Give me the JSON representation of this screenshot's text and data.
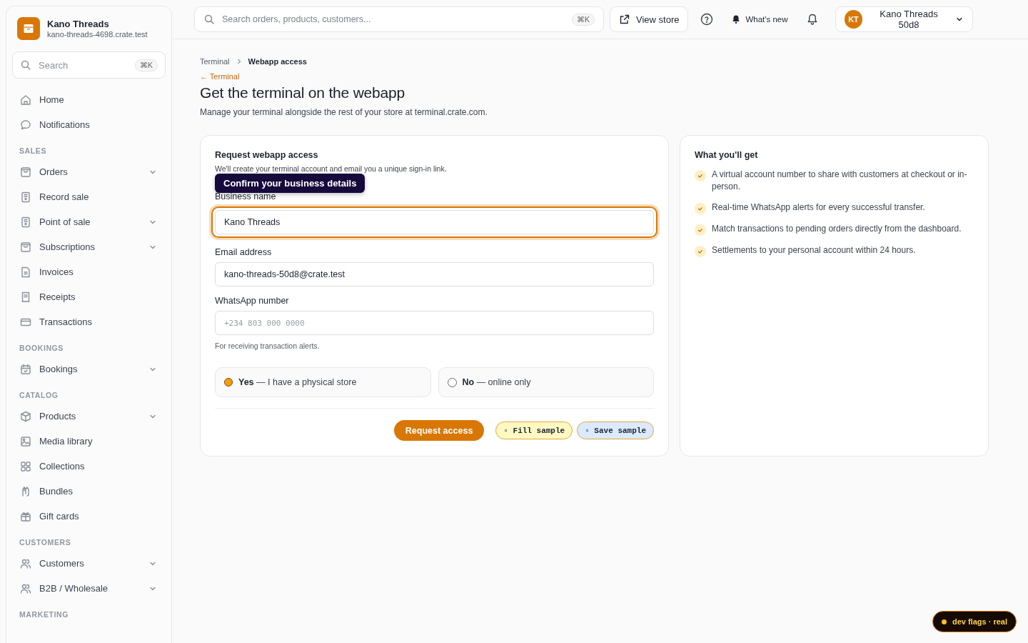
{
  "sidebar": {
    "store": {
      "name": "Kano Threads",
      "domain": "kano-threads-4698.crate.test"
    },
    "search": {
      "placeholder": "Search",
      "shortcut": "⌘K"
    },
    "top_items": [
      {
        "label": "Home",
        "expandable": false
      },
      {
        "label": "Notifications",
        "expandable": false
      }
    ],
    "sections": [
      {
        "heading": "SALES",
        "items": [
          {
            "label": "Orders",
            "expandable": true
          },
          {
            "label": "Record sale",
            "expandable": false
          },
          {
            "label": "Point of sale",
            "expandable": true
          },
          {
            "label": "Subscriptions",
            "expandable": true
          },
          {
            "label": "Invoices",
            "expandable": false
          },
          {
            "label": "Receipts",
            "expandable": false
          },
          {
            "label": "Transactions",
            "expandable": false
          }
        ]
      },
      {
        "heading": "BOOKINGS",
        "items": [
          {
            "label": "Bookings",
            "expandable": true
          }
        ]
      },
      {
        "heading": "CATALOG",
        "items": [
          {
            "label": "Products",
            "expandable": true
          },
          {
            "label": "Media library",
            "expandable": false
          },
          {
            "label": "Collections",
            "expandable": false
          },
          {
            "label": "Bundles",
            "expandable": false
          },
          {
            "label": "Gift cards",
            "expandable": false
          }
        ]
      },
      {
        "heading": "CUSTOMERS",
        "items": [
          {
            "label": "Customers",
            "expandable": true
          },
          {
            "label": "B2B / Wholesale",
            "expandable": true
          }
        ]
      },
      {
        "heading": "MARKETING"
      }
    ]
  },
  "topbar": {
    "search": {
      "placeholder": "Search orders, products, customers...",
      "shortcut": "⌘K"
    },
    "view_store": "View store",
    "whats_new": "What's new",
    "account": {
      "initials": "KT",
      "name": "Kano Threads 50d8"
    }
  },
  "breadcrumb": [
    "Terminal",
    "Webapp access"
  ],
  "back_link": "← Terminal",
  "title": "Get the terminal on the webapp",
  "subtitle": "Manage your terminal alongside the rest of your store at terminal.crate.com.",
  "form": {
    "title": "Request webapp access",
    "description": "We'll create your terminal account and email you a unique sign-in link.",
    "tooltip": "Confirm your business details",
    "fields": [
      {
        "label": "Business name",
        "value": "Kano Threads",
        "focused": true
      },
      {
        "label": "Email address",
        "value": "kano-threads-50d8@crate.test",
        "focused": false
      },
      {
        "label": "WhatsApp number",
        "placeholder": "+234 803 000 0000",
        "hint": "For receiving transaction alerts.",
        "focused": false
      }
    ],
    "options": [
      {
        "label": "**Yes** — I have a physical store",
        "selected": true
      },
      {
        "label": "**No** — online only",
        "selected": false
      }
    ],
    "submit": "Request access",
    "dev_buttons": [
      {
        "label": "▫ Fill sample",
        "color": "#fef9c3"
      },
      {
        "label": "▫ Save sample",
        "color": "#dbeafe"
      }
    ]
  },
  "benefits": {
    "title": "What you'll get",
    "items": [
      "A virtual account number to share with customers at checkout or in-person.",
      "Real-time WhatsApp alerts for every successful transfer.",
      "Match transactions to pending orders directly from the dashboard.",
      "Settlements to your personal account within 24 hours."
    ]
  },
  "dev_flags": "dev flags · real"
}
